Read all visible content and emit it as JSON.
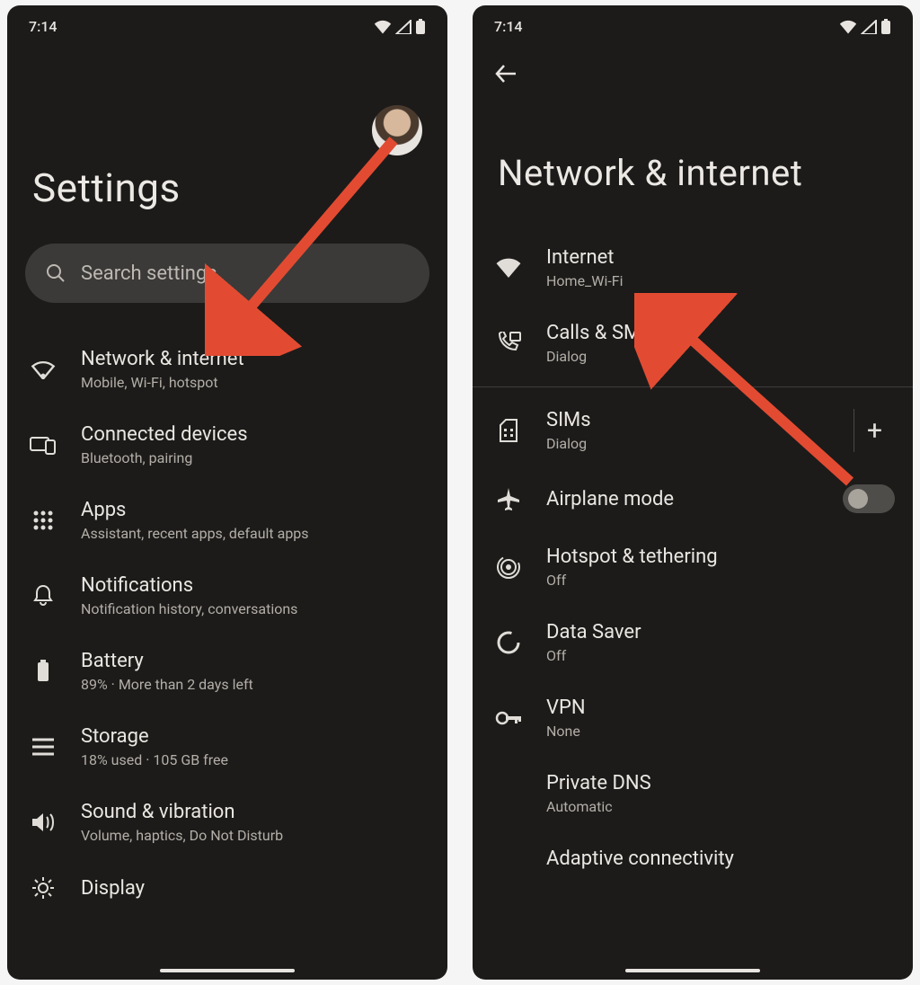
{
  "status": {
    "time": "7:14"
  },
  "left": {
    "title": "Settings",
    "search_placeholder": "Search settings",
    "items": [
      {
        "icon": "wifi-icon",
        "title": "Network & internet",
        "sub": "Mobile, Wi-Fi, hotspot"
      },
      {
        "icon": "devices-icon",
        "title": "Connected devices",
        "sub": "Bluetooth, pairing"
      },
      {
        "icon": "apps-icon",
        "title": "Apps",
        "sub": "Assistant, recent apps, default apps"
      },
      {
        "icon": "bell-icon",
        "title": "Notifications",
        "sub": "Notification history, conversations"
      },
      {
        "icon": "battery-icon",
        "title": "Battery",
        "sub": "89% · More than 2 days left"
      },
      {
        "icon": "storage-icon",
        "title": "Storage",
        "sub": "18% used · 105 GB free"
      },
      {
        "icon": "sound-icon",
        "title": "Sound & vibration",
        "sub": "Volume, haptics, Do Not Disturb"
      },
      {
        "icon": "display-icon",
        "title": "Display",
        "sub": ""
      }
    ]
  },
  "right": {
    "title": "Network & internet",
    "items_top": [
      {
        "icon": "wifi-fill-icon",
        "title": "Internet",
        "sub": "Home_Wi-Fi"
      },
      {
        "icon": "calls-icon",
        "title": "Calls & SMS",
        "sub": "Dialog"
      }
    ],
    "sims": {
      "icon": "sim-icon",
      "title": "SIMs",
      "sub": "Dialog",
      "add": "+"
    },
    "airplane": {
      "icon": "airplane-icon",
      "title": "Airplane mode"
    },
    "hotspot": {
      "icon": "hotspot-icon",
      "title": "Hotspot & tethering",
      "sub": "Off"
    },
    "saver": {
      "icon": "datasaver-icon",
      "title": "Data Saver",
      "sub": "Off"
    },
    "vpn": {
      "icon": "vpn-icon",
      "title": "VPN",
      "sub": "None"
    },
    "dns": {
      "title": "Private DNS",
      "sub": "Automatic"
    },
    "adaptive": {
      "title": "Adaptive connectivity"
    }
  },
  "annotation": {
    "color": "#e24b32"
  }
}
